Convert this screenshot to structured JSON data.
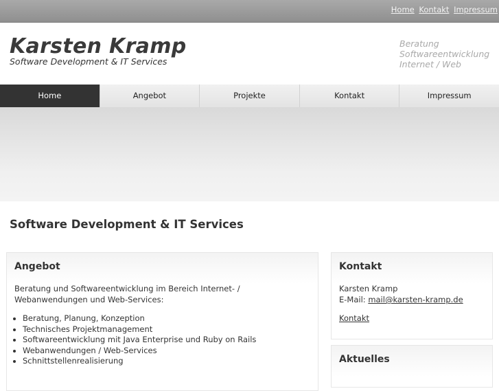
{
  "top_links": [
    "Home",
    "Kontakt",
    "Impressum"
  ],
  "logo": {
    "title": "Karsten Kramp",
    "subtitle": "Software Development & IT Services"
  },
  "tagline": [
    "Beratung",
    "Softwareentwicklung",
    "Internet / Web"
  ],
  "nav": [
    "Home",
    "Angebot",
    "Projekte",
    "Kontakt",
    "Impressum"
  ],
  "nav_active": "Home",
  "page_title": "Software Development & IT Services",
  "angebot": {
    "heading": "Angebot",
    "intro": "Beratung und Softwareentwicklung im Bereich Internet- / Webanwendungen und Web-Services:",
    "items": [
      "Beratung, Planung, Konzeption",
      "Technisches Projektmanagement",
      "Softwareentwicklung mit Java Enterprise und Ruby on Rails",
      "Webanwendungen / Web-Services",
      "Schnittstellenrealisierung"
    ]
  },
  "kontakt": {
    "heading": "Kontakt",
    "name": "Karsten Kramp",
    "email_label": "E-Mail:",
    "email": "mail@karsten-kramp.de",
    "link": "Kontakt"
  },
  "aktuelles": {
    "heading": "Aktuelles"
  }
}
